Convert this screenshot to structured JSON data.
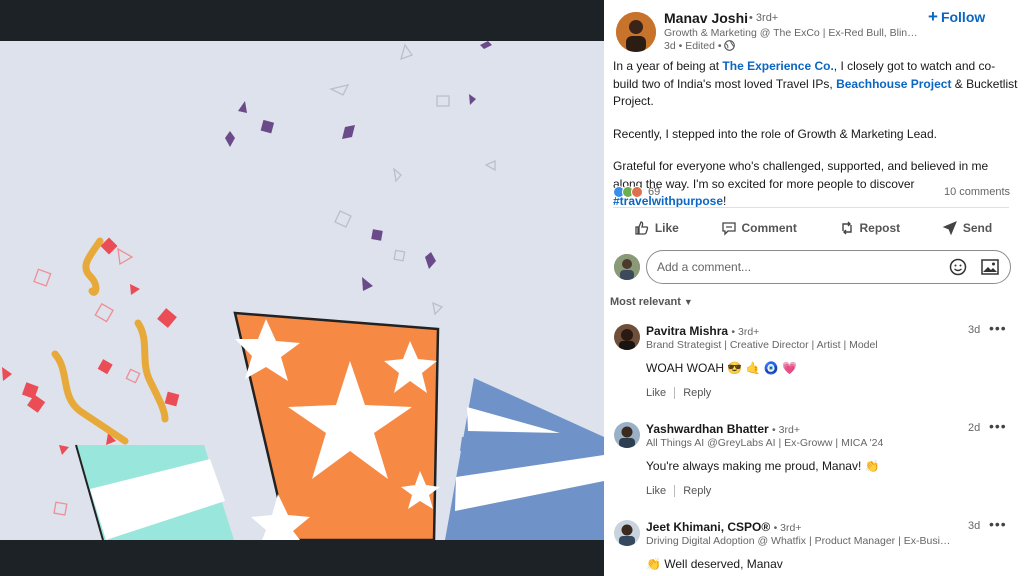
{
  "post": {
    "author": {
      "name": "Manav Joshi",
      "degree": "• 3rd+",
      "headline": "Growth & Marketing @ The ExCo | Ex-Red Bull, Blinkit | Ex-Shorthand",
      "meta": "3d • Edited •",
      "icon": "globe-icon"
    },
    "follow_label": "Follow",
    "body": {
      "p1_a": "In a year of being at ",
      "p1_link1": "The Experience Co.",
      "p1_b": ", I closely got to watch and co-build two of India's most loved Travel IPs, ",
      "p1_link2": "Beachhouse Project",
      "p1_c": " & Bucketlist Project.",
      "p2": "Recently, I stepped into the role of Growth & Marketing Lead.",
      "p3_a": "Grateful for everyone who's challenged, supported, and believed in me along the way. I'm so excited for more people to discover ",
      "p3_tag": "#travelwithpurpose",
      "p3_b": "!"
    },
    "reaction_count": "69",
    "comments_count": "10 comments",
    "actions": {
      "like": "Like",
      "comment": "Comment",
      "repost": "Repost",
      "send": "Send"
    }
  },
  "comment_input": {
    "placeholder": "Add a comment..."
  },
  "sort_label": "Most relevant",
  "comments": [
    {
      "name": "Pavitra Mishra",
      "degree": "• 3rd+",
      "headline": "Brand Strategist | Creative Director | Artist | Model",
      "time": "3d",
      "text": "WOAH WOAH 😎 🤙 🧿 💗",
      "like": "Like",
      "reply": "Reply"
    },
    {
      "name": "Yashwardhan Bhatter",
      "degree": "• 3rd+",
      "headline": "All Things AI @GreyLabs AI | Ex-Groww | MICA '24",
      "time": "2d",
      "text": "You're always making me proud, Manav! 👏",
      "like": "Like",
      "reply": "Reply"
    },
    {
      "name": "Jeet Khimani, CSPO®",
      "degree": "• 3rd+",
      "headline": "Driving Digital Adoption @ Whatfix | Product Manager | Ex-Business Analyst",
      "time": "3d",
      "text": "👏 Well deserved, Manav"
    }
  ],
  "colors": {
    "link": "#0a66c2",
    "image_bg": "#dde2ec",
    "cup_orange": "#f68a45",
    "cup_teal": "#98e6dc",
    "cup_blue": "#6f93c9",
    "confetti_red": "#ea4d55",
    "confetti_purple": "#6b4a8a",
    "streamer_yellow": "#e7aa3a"
  }
}
